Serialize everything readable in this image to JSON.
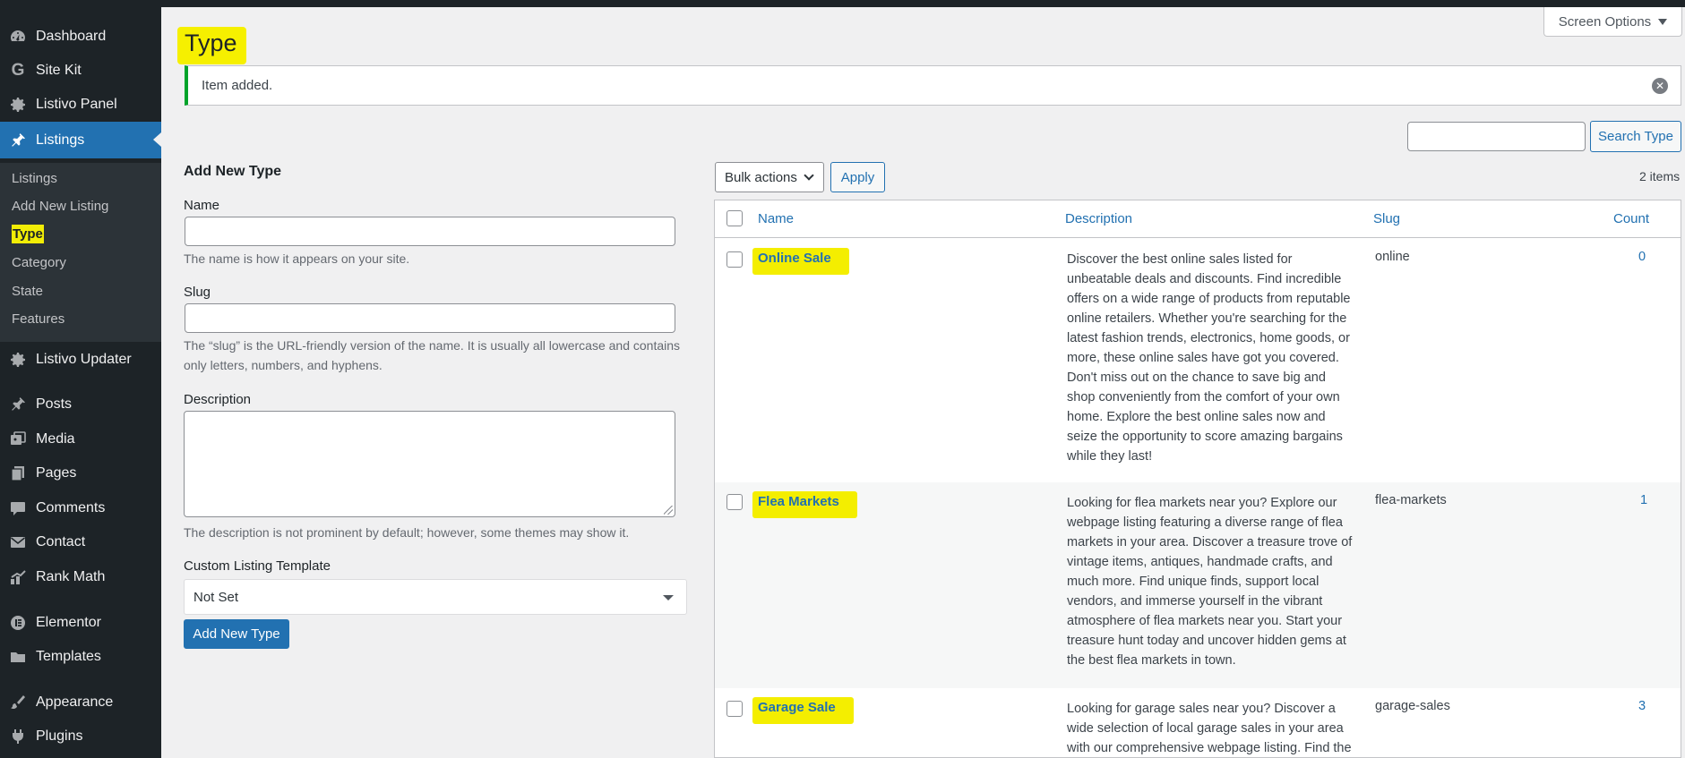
{
  "sidebar": {
    "items": [
      {
        "label": "Dashboard",
        "icon": "dashboard-icon"
      },
      {
        "label": "Site Kit",
        "icon": "google-icon"
      },
      {
        "label": "Listivo Panel",
        "icon": "gear-icon"
      },
      {
        "label": "Listings",
        "icon": "pin-icon"
      },
      {
        "label": "Listivo Updater",
        "icon": "gear-icon"
      },
      {
        "label": "Posts",
        "icon": "pin-icon"
      },
      {
        "label": "Media",
        "icon": "media-icon"
      },
      {
        "label": "Pages",
        "icon": "pages-icon"
      },
      {
        "label": "Comments",
        "icon": "comment-icon"
      },
      {
        "label": "Contact",
        "icon": "mail-icon"
      },
      {
        "label": "Rank Math",
        "icon": "rankmath-icon"
      },
      {
        "label": "Elementor",
        "icon": "elementor-icon"
      },
      {
        "label": "Templates",
        "icon": "folder-icon"
      },
      {
        "label": "Appearance",
        "icon": "brush-icon"
      },
      {
        "label": "Plugins",
        "icon": "plug-icon"
      }
    ],
    "submenu": [
      "Listings",
      "Add New Listing",
      "Type",
      "Category",
      "State",
      "Features"
    ]
  },
  "header": {
    "screen_options": "Screen Options",
    "title": "Type"
  },
  "notice": {
    "text": "Item added."
  },
  "search": {
    "button": "Search Type",
    "value": ""
  },
  "form": {
    "heading": "Add New Type",
    "name_label": "Name",
    "name_help": "The name is how it appears on your site.",
    "slug_label": "Slug",
    "slug_help": "The “slug” is the URL-friendly version of the name. It is usually all lowercase and contains only letters, numbers, and hyphens.",
    "description_label": "Description",
    "description_help": "The description is not prominent by default; however, some themes may show it.",
    "template_label": "Custom Listing Template",
    "template_value": "Not Set",
    "submit": "Add New Type"
  },
  "table": {
    "bulk_actions": "Bulk actions",
    "apply": "Apply",
    "items_count": "2 items",
    "columns": [
      "Name",
      "Description",
      "Slug",
      "Count"
    ],
    "rows": [
      {
        "name": "Online Sale",
        "description": "Discover the best online sales listed for unbeatable deals and discounts. Find incredible offers on a wide range of products from reputable online retailers. Whether you're searching for the latest fashion trends, electronics, home goods, or more, these online sales have got you covered. Don't miss out on the chance to save big and shop conveniently from the comfort of your own home. Explore the best online sales now and seize the opportunity to score amazing bargains while they last!",
        "slug": "online",
        "count": "0"
      },
      {
        "name": "Flea Markets",
        "description": "Looking for flea markets near you? Explore our webpage listing featuring a diverse range of flea markets in your area. Discover a treasure trove of vintage items, antiques, handmade crafts, and much more. Find unique finds, support local vendors, and immerse yourself in the vibrant atmosphere of flea markets near you. Start your treasure hunt today and uncover hidden gems at the best flea markets in town.",
        "slug": "flea-markets",
        "count": "1"
      },
      {
        "name": "Garage Sale",
        "description": "Looking for garage sales near you? Discover a wide selection of local garage sales in your area with our comprehensive webpage listing. Find the",
        "slug": "garage-sales",
        "count": "3"
      }
    ]
  }
}
